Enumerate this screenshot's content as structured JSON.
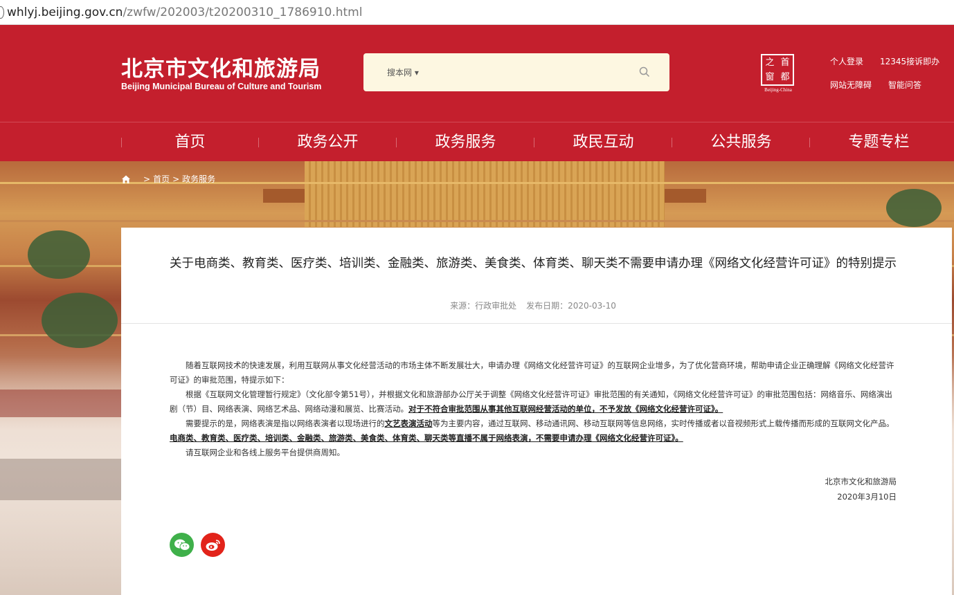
{
  "browser": {
    "url_host": "whlyj.beijing.gov.cn",
    "url_path": "/zwfw/202003/t20200310_1786910.html"
  },
  "header": {
    "logo_cn": "北京市文化和旅游局",
    "logo_en": "Beijing Municipal Bureau of Culture and Tourism",
    "search_scope": "搜本网 ▾",
    "search_value": "",
    "capital_logo": {
      "chars": [
        "之",
        "首",
        "窗",
        "都"
      ],
      "caption": "Beijing-China"
    },
    "links": [
      "个人登录",
      "12345接诉即办",
      "网站无障碍",
      "智能问答"
    ]
  },
  "nav": [
    "首页",
    "政务公开",
    "政务服务",
    "政民互动",
    "公共服务",
    "专题专栏"
  ],
  "breadcrumb": {
    "sep": ">",
    "items": [
      "首页",
      "政务服务"
    ]
  },
  "article": {
    "title": "关于电商类、教育类、医疗类、培训类、金融类、旅游类、美食类、体育类、聊天类不需要申请办理《网络文化经营许可证》的特别提示",
    "source_label": "来源：行政审批处",
    "date_label": "发布日期：2020-03-10",
    "paragraphs": {
      "p1": "随着互联网技术的快速发展，利用互联网从事文化经营活动的市场主体不断发展壮大，申请办理《网络文化经营许可证》的互联网企业增多，为了优化营商环境，帮助申请企业正确理解《网络文化经营许可证》的审批范围，特提示如下：",
      "p2_text": "根据《互联网文化管理暂行规定》（文化部令第51号），并根据文化和旅游部办公厅关于调整《网络文化经营许可证》审批范围的有关通知，《网络文化经营许可证》的审批范围包括：网络音乐、网络演出剧（节）目、网络表演、网络艺术品、网络动漫和展览、比赛活动。",
      "p2_emph": "对于不符合审批范围从事其他互联网经营活动的单位，不予发放《网络文化经营许可证》。",
      "p3_a": "需要提示的是，网络表演是指以网络表演者以现场进行的",
      "p3_emph1": "文艺表演活动",
      "p3_b": "等为主要内容，通过互联网、移动通讯网、移动互联网等信息网络，实时传播或者以音视频形式上载传播而形成的互联网文化产品。",
      "p3_emph2": "电商类、教育类、医疗类、培训类、金融类、旅游类、美食类、体育类、聊天类等直播不属于网络表演，不需要申请办理《网络文化经营许可证》。",
      "p4": "请互联网企业和各线上服务平台提供商周知。"
    },
    "signature_org": "北京市文化和旅游局",
    "signature_date": "2020年3月10日"
  },
  "share": {
    "wechat_color": "#3fb04a",
    "weibo_color": "#e2231a"
  }
}
